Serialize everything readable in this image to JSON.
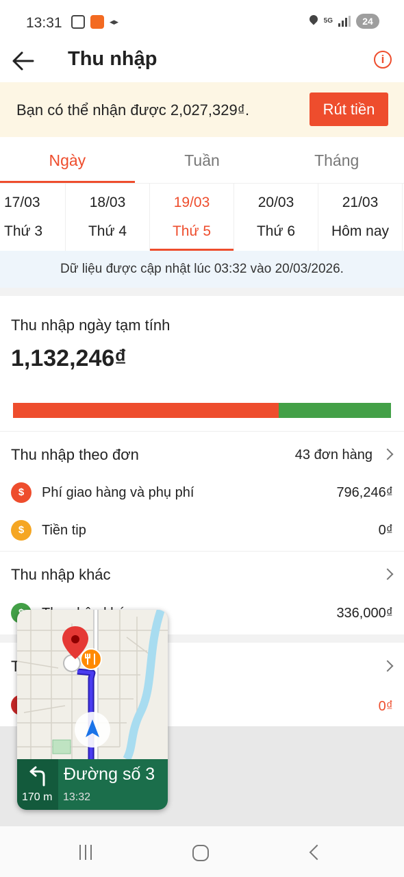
{
  "status_bar": {
    "time": "13:31",
    "battery": "24",
    "network": "5G"
  },
  "header": {
    "title": "Thu nhập",
    "back_icon": "arrow-left-icon",
    "info_icon": "info-icon"
  },
  "withdraw": {
    "text": "Bạn có thể nhận được 2,027,329₫.",
    "button": "Rút tiền"
  },
  "period_tabs": [
    {
      "label": "Ngày",
      "active": true
    },
    {
      "label": "Tuần",
      "active": false
    },
    {
      "label": "Tháng",
      "active": false
    }
  ],
  "dates": [
    {
      "date": "17/03",
      "weekday": "Thứ 3"
    },
    {
      "date": "18/03",
      "weekday": "Thứ 4"
    },
    {
      "date": "19/03",
      "weekday": "Thứ 5",
      "active": true
    },
    {
      "date": "20/03",
      "weekday": "Thứ 6"
    },
    {
      "date": "21/03",
      "weekday": "Hôm nay"
    }
  ],
  "update_note": "Dữ liệu được cập nhật lúc 03:32 vào 20/03/2026.",
  "summary": {
    "label": "Thu nhập ngày tạm tính",
    "amount": "1,132,246₫",
    "order_share_percent": 70.3,
    "colors": {
      "order": "#ee4d2d",
      "other": "#43a047"
    }
  },
  "order_income": {
    "title": "Thu nhập theo đơn",
    "orders": "43 đơn hàng",
    "rows": [
      {
        "icon_text": "$",
        "icon_color": "#ee4d2d",
        "label": "Phí giao hàng và phụ phí",
        "value": "796,246₫"
      },
      {
        "icon_text": "$",
        "icon_color": "#f5a623",
        "label": "Tiền tip",
        "value": "0₫"
      }
    ]
  },
  "other_income": {
    "title": "Thu nhập khác",
    "row": {
      "icon_text": "$",
      "icon_color": "#43a047",
      "label": "Thu nhập khác",
      "value": "336,000₫"
    }
  },
  "third_section": {
    "title_initial": "T",
    "row": {
      "icon_color": "#c62828",
      "value": "0₫",
      "value_color": "#ee4d2d"
    }
  },
  "map_overlay": {
    "street": "Đường số 3",
    "distance": "170 m",
    "eta": "13:32",
    "turn_icon": "turn-left-icon"
  },
  "nav_bar": {
    "recent_icon": "recent-apps-icon",
    "home_icon": "home-icon",
    "back_icon": "back-icon"
  }
}
